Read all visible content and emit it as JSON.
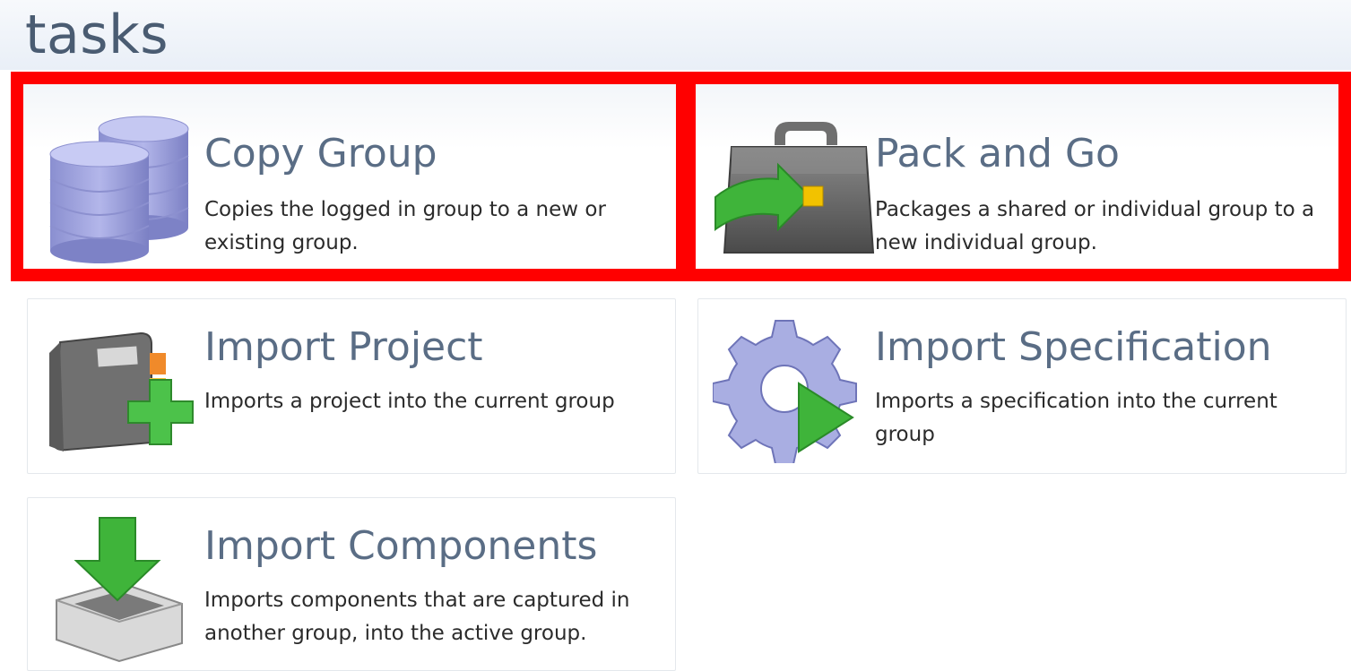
{
  "header": {
    "title": "tasks"
  },
  "tasks": [
    {
      "title": "Copy Group",
      "description": "Copies the logged in group to a new or existing group.",
      "icon": "database-stack-icon",
      "highlighted": true
    },
    {
      "title": "Pack and Go",
      "description": "Packages a shared or individual group to a new individual group.",
      "icon": "briefcase-arrow-icon",
      "highlighted": true
    },
    {
      "title": "Import Project",
      "description": "Imports a project into the current group",
      "icon": "book-plus-icon",
      "highlighted": false
    },
    {
      "title": "Import Specification",
      "description": "Imports a specification into the current group",
      "icon": "gear-play-icon",
      "highlighted": false
    },
    {
      "title": "Import Components",
      "description": "Imports components that are captured in another group, into the active group.",
      "icon": "tray-download-icon",
      "highlighted": false
    }
  ],
  "colors": {
    "highlight": "#ff0000",
    "title": "#5a6d85",
    "accent_green": "#3fb43a"
  }
}
